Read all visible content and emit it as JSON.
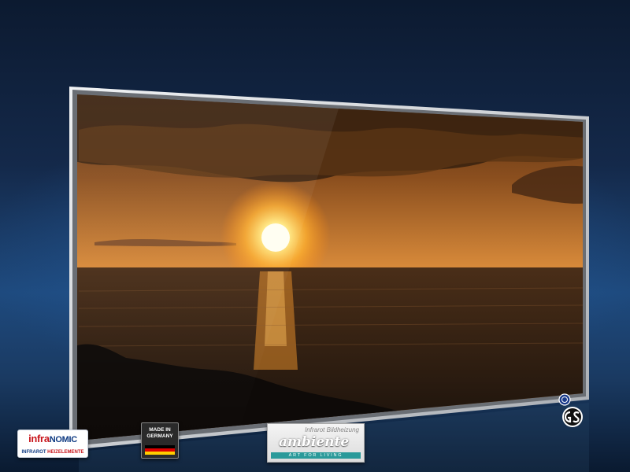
{
  "badges": {
    "infranomic": {
      "brand_part1": "infra",
      "brand_part2": "NOMIC",
      "tagline_part1": "INFRAROT ",
      "tagline_part2": "HEIZELEMENTE"
    },
    "made_in_germany": {
      "text": "MADE IN GERMANY"
    },
    "ambiente": {
      "top_text": "Infrarot Bildheizung",
      "logo": "ambiente",
      "slogan": "ART FOR LIVING"
    },
    "certification": {
      "icons": [
        "tuv-icon",
        "gs-mark-icon"
      ]
    }
  },
  "colors": {
    "background_top": "#0c1a30",
    "background_mid": "#1e4a7e",
    "frame": "#d6d8dc",
    "sunset_orange": "#d4781e",
    "sea": "#2a1e14",
    "brand_red": "#c8151b",
    "brand_blue": "#0e3a82",
    "ambiente_teal": "#2a9a9a"
  }
}
